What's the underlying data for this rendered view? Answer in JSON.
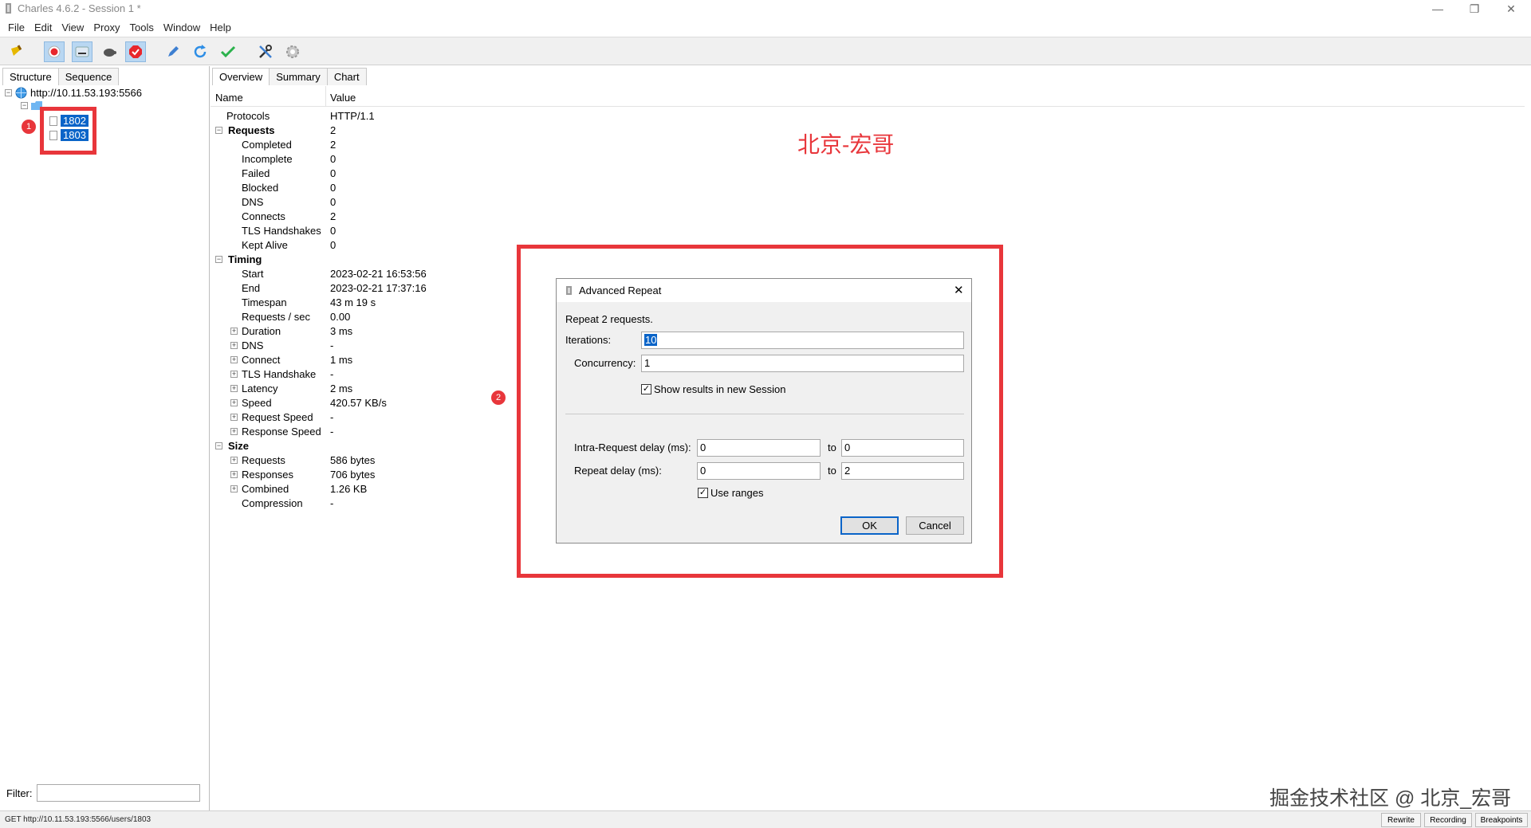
{
  "window": {
    "title": "Charles 4.6.2 - Session 1 *"
  },
  "menu": [
    "File",
    "Edit",
    "View",
    "Proxy",
    "Tools",
    "Window",
    "Help"
  ],
  "toolbar": {
    "icons": [
      "broom-icon",
      "record-icon",
      "throttle-icon",
      "turtle-icon",
      "breakpoint-icon",
      "compose-icon",
      "repeat-icon",
      "validate-icon",
      "tools-icon",
      "settings-icon"
    ]
  },
  "left": {
    "tabs": [
      "Structure",
      "Sequence"
    ],
    "host": "http://10.11.53.193:5566",
    "items": [
      "1802",
      "1803"
    ],
    "filter_label": "Filter:",
    "filter_value": ""
  },
  "right": {
    "tabs": [
      "Overview",
      "Summary",
      "Chart"
    ],
    "columns": [
      "Name",
      "Value"
    ],
    "rows": [
      {
        "name": "Protocols",
        "value": "HTTP/1.1",
        "level": 1,
        "kind": "leaf"
      },
      {
        "name": "Requests",
        "value": "2",
        "level": 0,
        "kind": "section"
      },
      {
        "name": "Completed",
        "value": "2",
        "level": 2,
        "kind": "leaf"
      },
      {
        "name": "Incomplete",
        "value": "0",
        "level": 2,
        "kind": "leaf"
      },
      {
        "name": "Failed",
        "value": "0",
        "level": 2,
        "kind": "leaf"
      },
      {
        "name": "Blocked",
        "value": "0",
        "level": 2,
        "kind": "leaf"
      },
      {
        "name": "DNS",
        "value": "0",
        "level": 2,
        "kind": "leaf"
      },
      {
        "name": "Connects",
        "value": "2",
        "level": 2,
        "kind": "leaf"
      },
      {
        "name": "TLS Handshakes",
        "value": "0",
        "level": 2,
        "kind": "leaf"
      },
      {
        "name": "Kept Alive",
        "value": "0",
        "level": 2,
        "kind": "leaf"
      },
      {
        "name": "Timing",
        "value": "",
        "level": 0,
        "kind": "section"
      },
      {
        "name": "Start",
        "value": "2023-02-21 16:53:56",
        "level": 2,
        "kind": "leaf"
      },
      {
        "name": "End",
        "value": "2023-02-21 17:37:16",
        "level": 2,
        "kind": "leaf"
      },
      {
        "name": "Timespan",
        "value": "43 m 19 s",
        "level": 2,
        "kind": "leaf"
      },
      {
        "name": "Requests / sec",
        "value": "0.00",
        "level": 2,
        "kind": "leaf"
      },
      {
        "name": "Duration",
        "value": "3 ms",
        "level": 2,
        "kind": "collapsed"
      },
      {
        "name": "DNS",
        "value": "-",
        "level": 2,
        "kind": "collapsed"
      },
      {
        "name": "Connect",
        "value": "1 ms",
        "level": 2,
        "kind": "collapsed"
      },
      {
        "name": "TLS Handshake",
        "value": "-",
        "level": 2,
        "kind": "collapsed"
      },
      {
        "name": "Latency",
        "value": "2 ms",
        "level": 2,
        "kind": "collapsed"
      },
      {
        "name": "Speed",
        "value": "420.57 KB/s",
        "level": 2,
        "kind": "collapsed"
      },
      {
        "name": "Request Speed",
        "value": "-",
        "level": 2,
        "kind": "collapsed"
      },
      {
        "name": "Response Speed",
        "value": "-",
        "level": 2,
        "kind": "collapsed"
      },
      {
        "name": "Size",
        "value": "",
        "level": 0,
        "kind": "section"
      },
      {
        "name": "Requests",
        "value": "586 bytes",
        "level": 2,
        "kind": "collapsed"
      },
      {
        "name": "Responses",
        "value": "706 bytes",
        "level": 2,
        "kind": "collapsed"
      },
      {
        "name": "Combined",
        "value": "1.26 KB",
        "level": 2,
        "kind": "collapsed"
      },
      {
        "name": "Compression",
        "value": "-",
        "level": 2,
        "kind": "leaf"
      }
    ]
  },
  "annotations": {
    "badge1": "1",
    "badge2": "2",
    "red_text": "北京-宏哥",
    "watermark": "掘金技术社区 @ 北京_宏哥"
  },
  "dialog": {
    "title": "Advanced Repeat",
    "intro": "Repeat 2 requests.",
    "iterations_label": "Iterations:",
    "iterations_value": "10",
    "concurrency_label": "Concurrency:",
    "concurrency_value": "1",
    "show_results_label": "Show results in new Session",
    "show_results_checked": "✓",
    "intra_delay_label": "Intra-Request delay (ms):",
    "intra_from": "0",
    "intra_to": "0",
    "repeat_delay_label": "Repeat delay (ms):",
    "repeat_from": "0",
    "repeat_to": "2",
    "to_label": "to",
    "use_ranges_label": "Use ranges",
    "use_ranges_checked": "✓",
    "ok": "OK",
    "cancel": "Cancel"
  },
  "status": {
    "text": "GET http://10.11.53.193:5566/users/1803",
    "buttons": [
      "Rewrite",
      "Recording",
      "Breakpoints"
    ]
  }
}
